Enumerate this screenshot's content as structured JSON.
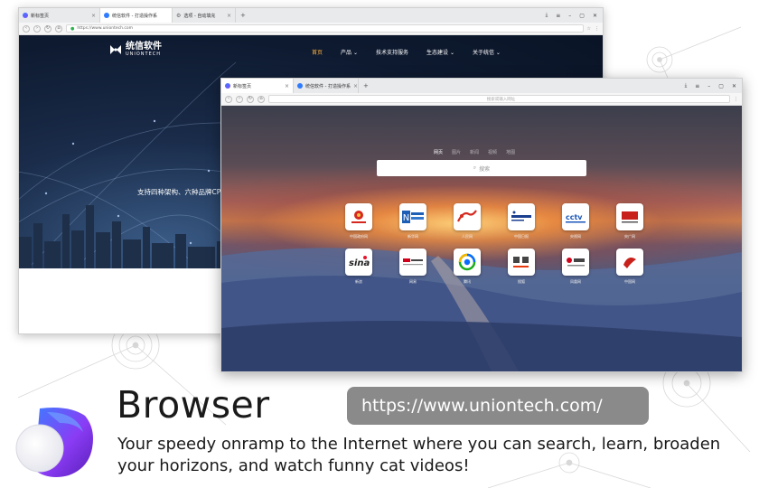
{
  "back_window": {
    "tabs": [
      {
        "label": "新标签页",
        "icon": "deepin-browser-icon",
        "active": false
      },
      {
        "label": "统信软件 - 打造操作系",
        "icon": "uniontech-icon",
        "active": true
      },
      {
        "label": "选项 - 自动填充",
        "icon": "settings-icon",
        "active": false
      }
    ],
    "url": "https://www.uniontech.com",
    "site": {
      "logo_cn": "统信软件",
      "logo_en": "UNIONTECH",
      "nav": [
        "首页",
        "产品",
        "技术支持服务",
        "生态建设",
        "关于统信"
      ],
      "slogan": "支持四种架构、六种品牌CPU"
    }
  },
  "front_window": {
    "tabs": [
      {
        "label": "新标签页",
        "icon": "deepin-browser-icon",
        "active": true
      },
      {
        "label": "统信软件 - 打造操作系",
        "icon": "uniontech-icon",
        "active": false
      }
    ],
    "address_placeholder": "搜索或输入网址",
    "search_tabs": [
      "网页",
      "图片",
      "新闻",
      "视频",
      "地图"
    ],
    "search_placeholder": "搜索",
    "sites": [
      {
        "name": "中国政府网",
        "logo": "gov-emblem"
      },
      {
        "name": "新华网",
        "logo": "xinhua-news"
      },
      {
        "name": "人民网",
        "logo": "people-daily"
      },
      {
        "name": "中国日报",
        "logo": "china-daily"
      },
      {
        "name": "央视网",
        "logo": "cctv"
      },
      {
        "name": "央广网",
        "logo": "cnr"
      },
      {
        "name": "新浪",
        "logo": "sina"
      },
      {
        "name": "网易",
        "logo": "netease"
      },
      {
        "name": "腾讯",
        "logo": "tencent"
      },
      {
        "name": "搜狐",
        "logo": "sohu"
      },
      {
        "name": "凤凰网",
        "logo": "ifeng"
      },
      {
        "name": "中国网",
        "logo": "china-net"
      }
    ]
  },
  "app": {
    "title": "Browser",
    "url": "https://www.uniontech.com/",
    "description": "Your speedy onramp to the Internet where you can search, learn, broaden your horizons, and watch funny cat videos!"
  },
  "colors": {
    "accent_orange": "#ffb13d",
    "pill_gray": "#8a8a8a",
    "icon_blue": "#3f7bff",
    "icon_purple": "#8a3cf5"
  }
}
